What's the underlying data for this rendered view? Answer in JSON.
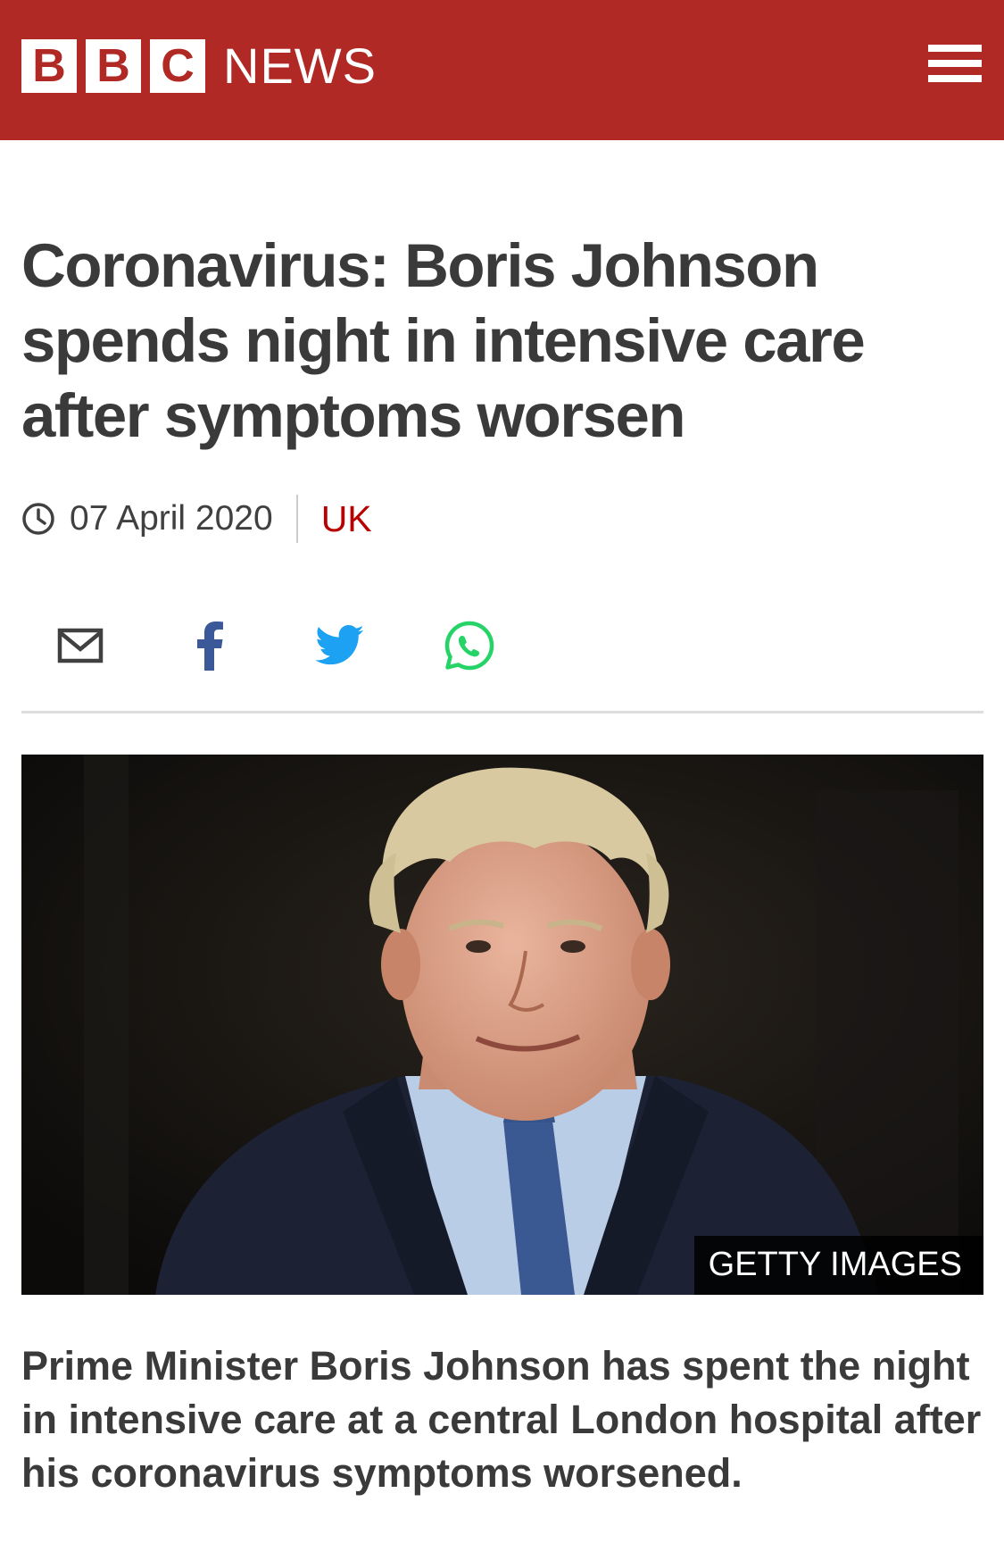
{
  "header": {
    "logo_letters": [
      "B",
      "B",
      "C"
    ],
    "logo_news": "NEWS",
    "menu_icon": "hamburger-menu-icon",
    "bg_color": "#b12925"
  },
  "article": {
    "headline": "Coronavirus: Boris Johnson spends night in intensive care after symptoms worsen",
    "date": "07 April 2020",
    "section": "UK",
    "section_color": "#b80000"
  },
  "share": {
    "icons": [
      "email-icon",
      "facebook-icon",
      "twitter-icon",
      "whatsapp-icon"
    ],
    "colors": {
      "email": "#404040",
      "facebook": "#3b5998",
      "twitter": "#1da1f2",
      "whatsapp": "#25d366"
    }
  },
  "image": {
    "credit": "GETTY IMAGES"
  },
  "intro": "Prime Minister Boris Johnson has spent the night in intensive care at a central London hospital after his coronavirus symptoms worsened."
}
